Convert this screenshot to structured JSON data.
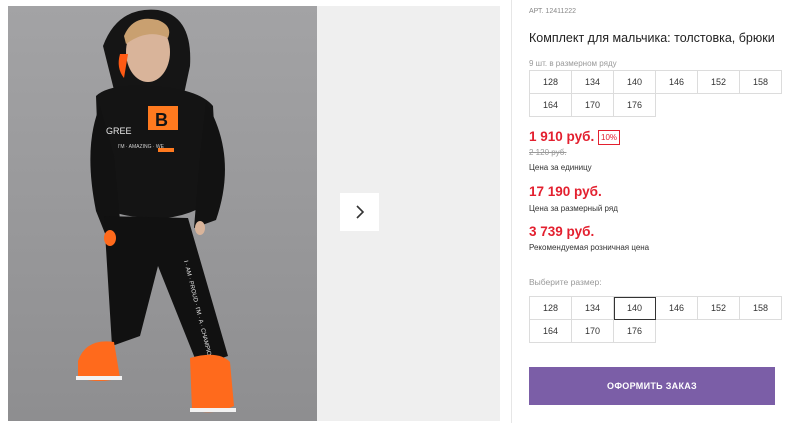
{
  "gallery": {
    "next_icon": "chevron-right-icon"
  },
  "product": {
    "sku_prefix": "АРТ.",
    "sku": "12411222",
    "title": "Комплект для мальчика: толстовка, брюки",
    "pack_note": "9 шт. в размерном ряду",
    "pack_sizes": [
      "128",
      "134",
      "140",
      "146",
      "152",
      "158",
      "164",
      "170",
      "176"
    ],
    "price": "1 910 руб.",
    "discount": "10%",
    "old_price": "2 120 руб.",
    "price_caption": "Цена за единицу",
    "set_price": "17 190 руб.",
    "set_price_caption": "Цена за размерный ряд",
    "rrp": "3 739 руб.",
    "rrp_caption": "Рекомендуемая розничная цена"
  },
  "size_picker": {
    "label": "Выберите размер:",
    "sizes": [
      "128",
      "134",
      "140",
      "146",
      "152",
      "158",
      "164",
      "170",
      "176"
    ],
    "selected": "140"
  },
  "order_button": {
    "label": "ОФОРМИТЬ ЗАКАЗ"
  },
  "colors": {
    "accent": "#7b5ea7",
    "price_red": "#e3202f"
  }
}
